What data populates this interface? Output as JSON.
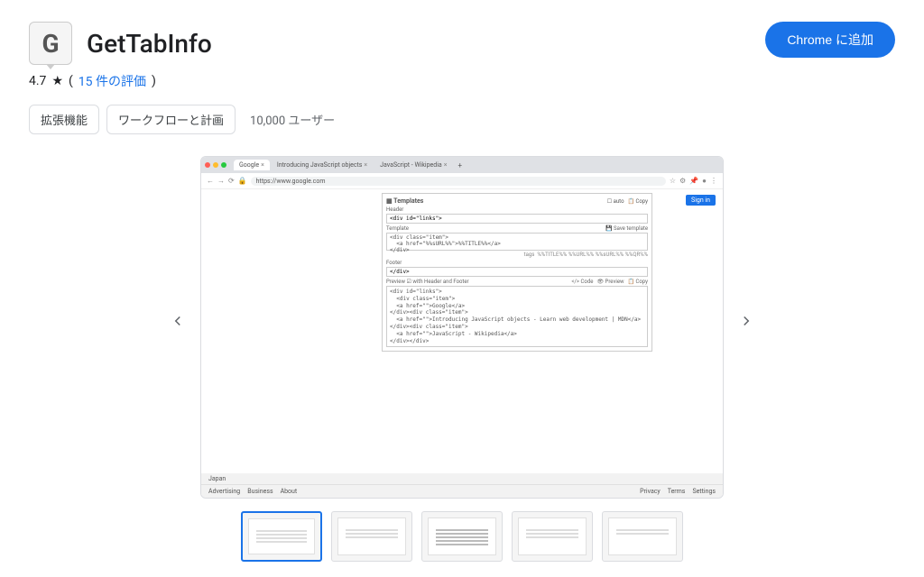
{
  "extension": {
    "icon_letter": "G",
    "name": "GetTabInfo",
    "add_button": "Chrome に追加",
    "rating": "4.7",
    "reviews_text": "15 件の評価",
    "chips": [
      "拡張機能",
      "ワークフローと計画"
    ],
    "users": "10,000 ユーザー"
  },
  "screenshot": {
    "tabs": [
      {
        "title": "Google",
        "active": true
      },
      {
        "title": "Introducing JavaScript objects",
        "active": false
      },
      {
        "title": "JavaScript - Wikipedia",
        "active": false
      }
    ],
    "url": "https://www.google.com",
    "signin": "Sign in",
    "panel": {
      "title": "Templates",
      "auto": "auto",
      "copy": "Copy",
      "header_label": "Header",
      "header_value": "<div id=\"links\">",
      "template_label": "Template",
      "save_template": "Save template",
      "template_value": "<div class=\"item\">\n  <a href=\"%%sURL%%\">%%TITLE%%</a>\n</div>",
      "tags_label": "tags",
      "tags": "%%TITLE%%   %%URL%%   %%sURL%%   %%QR%%",
      "footer_label": "Footer",
      "footer_value": "</div>",
      "preview_label": "Preview",
      "with_hf": "with Header and Footer",
      "code": "Code",
      "preview_btn": "Preview",
      "copy_btn": "Copy",
      "preview_content": "<div id=\"links\">\n  <div class=\"item\">\n  <a href=\"\">Google</a>\n</div><div class=\"item\">\n  <a href=\"\">Introducing JavaScript objects - Learn web development | MDN</a>\n</div><div class=\"item\">\n  <a href=\"\">JavaScript - Wikipedia</a>\n</div></div>"
    },
    "footer": {
      "country": "Japan",
      "left": [
        "Advertising",
        "Business",
        "About"
      ],
      "right": [
        "Privacy",
        "Terms",
        "Settings"
      ]
    }
  }
}
